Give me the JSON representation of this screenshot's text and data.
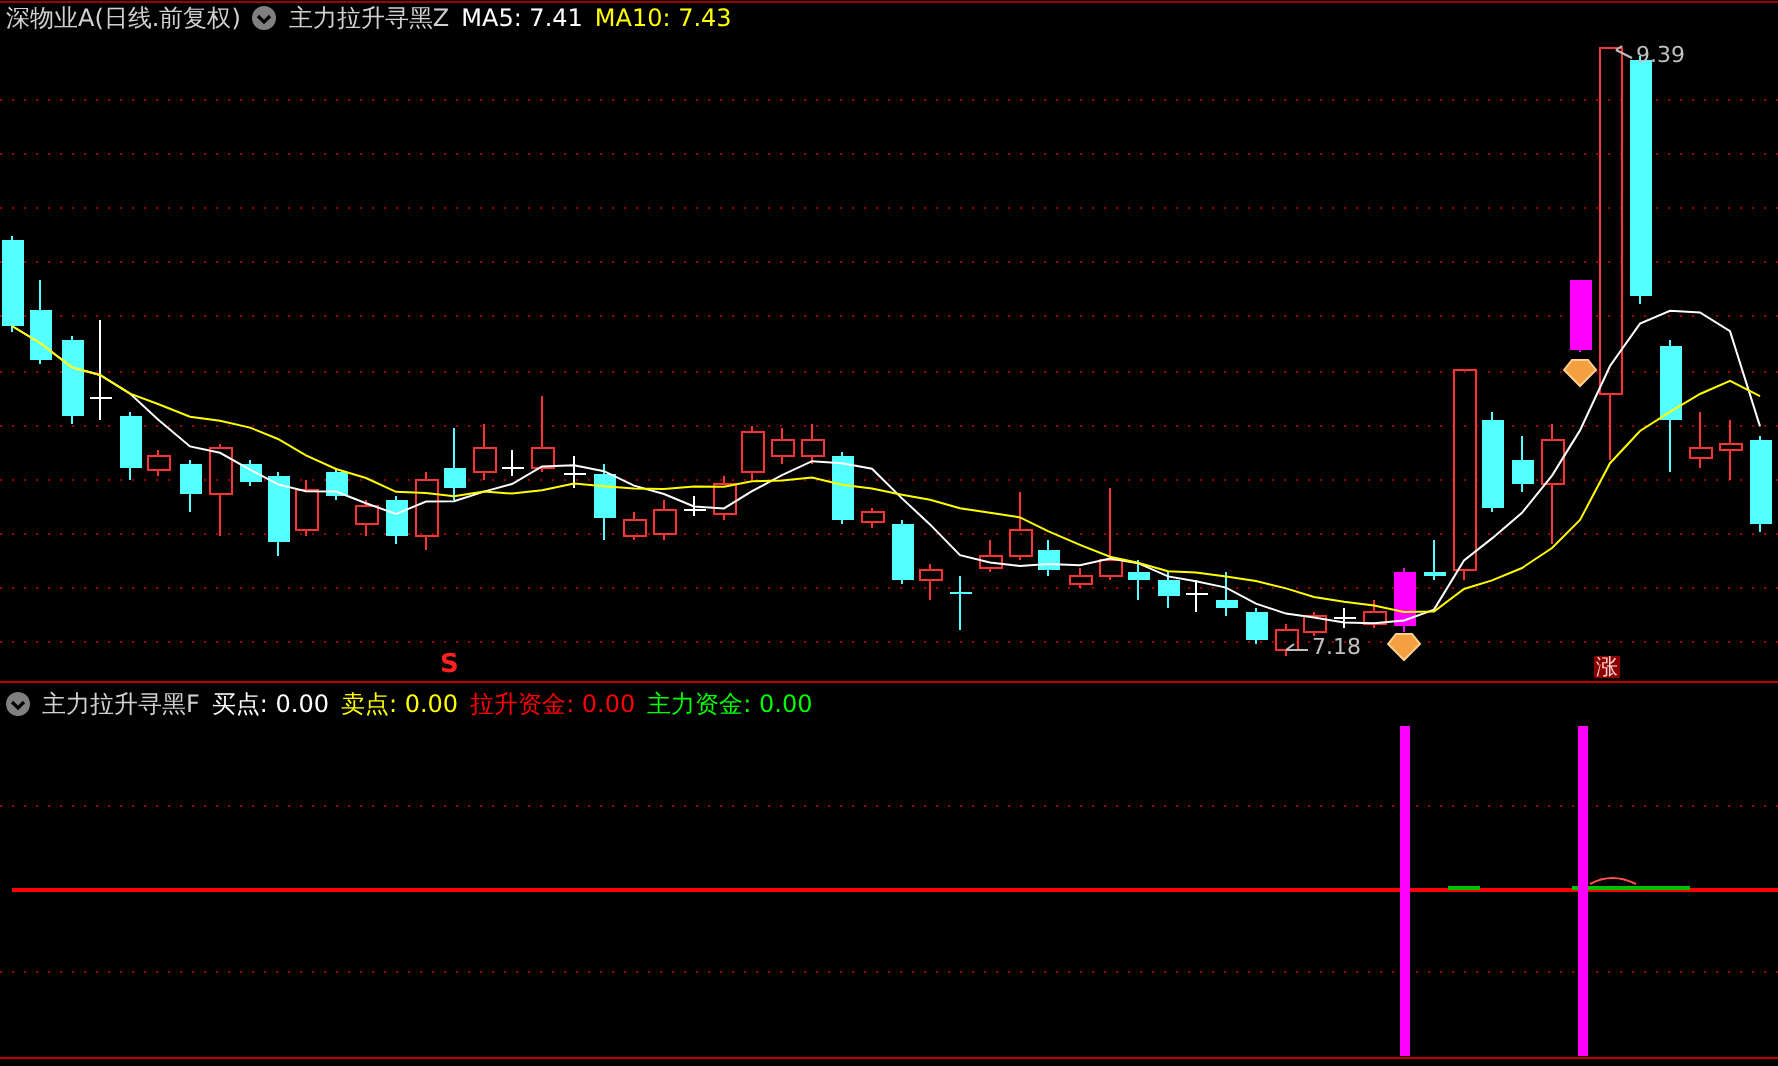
{
  "main_pane": {
    "title": "深物业A(日线.前复权)",
    "indicator": "主力拉升寻黑Z",
    "ma": [
      {
        "label": "MA5: 7.41",
        "color": "#ffffff"
      },
      {
        "label": "MA10: 7.43",
        "color": "#ffff00"
      }
    ],
    "low_label": "7.18",
    "high_label": "9.39",
    "signal_markers": [
      {
        "text": "S",
        "kind": "sell"
      },
      {
        "text": "涨",
        "kind": "rise"
      }
    ]
  },
  "sub_pane": {
    "indicator": "主力拉升寻黑F",
    "values": [
      {
        "label": "买点: 0.00",
        "color": "#ffffff"
      },
      {
        "label": "卖点: 0.00",
        "color": "#ffff00"
      },
      {
        "label": "拉升资金: 0.00",
        "color": "#ff0000"
      },
      {
        "label": "主力资金: 0.00",
        "color": "#00ff00"
      }
    ]
  }
}
